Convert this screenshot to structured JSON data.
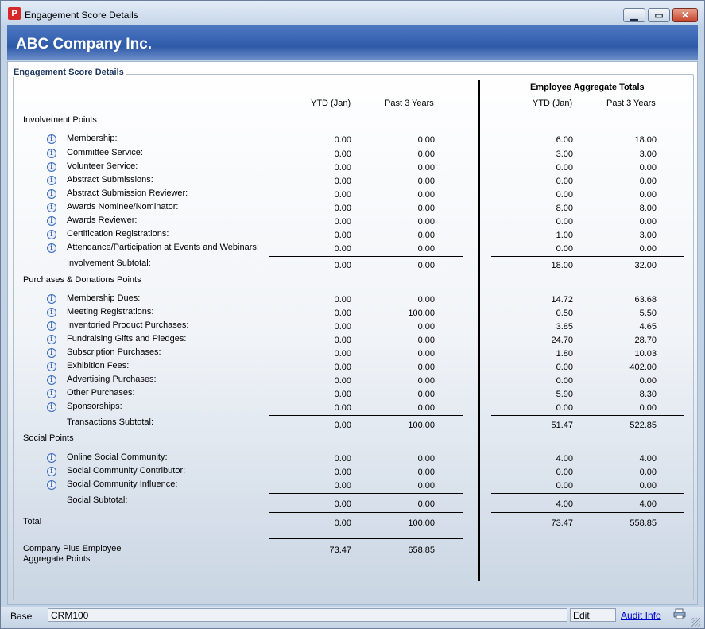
{
  "window": {
    "title": "Engagement Score Details",
    "app_icon": "P"
  },
  "banner": {
    "company": "ABC Company  Inc."
  },
  "section_title": "Engagement Score Details",
  "headers": {
    "ytd": "YTD (Jan)",
    "past3": "Past 3 Years",
    "employee_totals": "Employee Aggregate Totals",
    "emp_ytd": "YTD (Jan)",
    "emp_past3": "Past 3 Years"
  },
  "groups": [
    {
      "title": "Involvement Points",
      "rows": [
        {
          "label": "Membership:",
          "ytd": "0.00",
          "past3": "0.00",
          "emp_ytd": "6.00",
          "emp_past3": "18.00"
        },
        {
          "label": "Committee Service:",
          "ytd": "0.00",
          "past3": "0.00",
          "emp_ytd": "3.00",
          "emp_past3": "3.00"
        },
        {
          "label": "Volunteer Service:",
          "ytd": "0.00",
          "past3": "0.00",
          "emp_ytd": "0.00",
          "emp_past3": "0.00"
        },
        {
          "label": "Abstract Submissions:",
          "ytd": "0.00",
          "past3": "0.00",
          "emp_ytd": "0.00",
          "emp_past3": "0.00"
        },
        {
          "label": "Abstract Submission Reviewer:",
          "ytd": "0.00",
          "past3": "0.00",
          "emp_ytd": "0.00",
          "emp_past3": "0.00"
        },
        {
          "label": "Awards Nominee/Nominator:",
          "ytd": "0.00",
          "past3": "0.00",
          "emp_ytd": "8.00",
          "emp_past3": "8.00"
        },
        {
          "label": "Awards Reviewer:",
          "ytd": "0.00",
          "past3": "0.00",
          "emp_ytd": "0.00",
          "emp_past3": "0.00"
        },
        {
          "label": "Certification Registrations:",
          "ytd": "0.00",
          "past3": "0.00",
          "emp_ytd": "1.00",
          "emp_past3": "3.00"
        },
        {
          "label": "Attendance/Participation at Events and Webinars:",
          "ytd": "0.00",
          "past3": "0.00",
          "emp_ytd": "0.00",
          "emp_past3": "0.00"
        }
      ],
      "subtotal": {
        "label": "Involvement Subtotal:",
        "ytd": "0.00",
        "past3": "0.00",
        "emp_ytd": "18.00",
        "emp_past3": "32.00"
      }
    },
    {
      "title": "Purchases & Donations Points",
      "rows": [
        {
          "label": "Membership Dues:",
          "ytd": "0.00",
          "past3": "0.00",
          "emp_ytd": "14.72",
          "emp_past3": "63.68"
        },
        {
          "label": "Meeting Registrations:",
          "ytd": "0.00",
          "past3": "100.00",
          "emp_ytd": "0.50",
          "emp_past3": "5.50"
        },
        {
          "label": "Inventoried Product Purchases:",
          "ytd": "0.00",
          "past3": "0.00",
          "emp_ytd": "3.85",
          "emp_past3": "4.65"
        },
        {
          "label": "Fundraising Gifts and Pledges:",
          "ytd": "0.00",
          "past3": "0.00",
          "emp_ytd": "24.70",
          "emp_past3": "28.70"
        },
        {
          "label": "Subscription Purchases:",
          "ytd": "0.00",
          "past3": "0.00",
          "emp_ytd": "1.80",
          "emp_past3": "10.03"
        },
        {
          "label": "Exhibition Fees:",
          "ytd": "0.00",
          "past3": "0.00",
          "emp_ytd": "0.00",
          "emp_past3": "402.00"
        },
        {
          "label": "Advertising Purchases:",
          "ytd": "0.00",
          "past3": "0.00",
          "emp_ytd": "0.00",
          "emp_past3": "0.00"
        },
        {
          "label": "Other Purchases:",
          "ytd": "0.00",
          "past3": "0.00",
          "emp_ytd": "5.90",
          "emp_past3": "8.30"
        },
        {
          "label": "Sponsorships:",
          "ytd": "0.00",
          "past3": "0.00",
          "emp_ytd": "0.00",
          "emp_past3": "0.00"
        }
      ],
      "subtotal": {
        "label": "Transactions Subtotal:",
        "ytd": "0.00",
        "past3": "100.00",
        "emp_ytd": "51.47",
        "emp_past3": "522.85"
      }
    },
    {
      "title": "Social Points",
      "rows": [
        {
          "label": "Online Social Community:",
          "ytd": "0.00",
          "past3": "0.00",
          "emp_ytd": "4.00",
          "emp_past3": "4.00"
        },
        {
          "label": "Social Community Contributor:",
          "ytd": "0.00",
          "past3": "0.00",
          "emp_ytd": "0.00",
          "emp_past3": "0.00"
        },
        {
          "label": "Social Community Influence:",
          "ytd": "0.00",
          "past3": "0.00",
          "emp_ytd": "0.00",
          "emp_past3": "0.00"
        }
      ],
      "subtotal": {
        "label": "Social Subtotal:",
        "ytd": "0.00",
        "past3": "0.00",
        "emp_ytd": "4.00",
        "emp_past3": "4.00"
      }
    }
  ],
  "total": {
    "label": "Total",
    "ytd": "0.00",
    "past3": "100.00",
    "emp_ytd": "73.47",
    "emp_past3": "558.85"
  },
  "company_plus": {
    "label_line1": "Company Plus Employee",
    "label_line2": "Aggregate Points",
    "ytd": "73.47",
    "past3": "658.85"
  },
  "statusbar": {
    "base": "Base",
    "code": "CRM100",
    "mode": "Edit",
    "audit_link": "Audit Info"
  },
  "colors": {
    "banner": "#2e5aa8",
    "section_title": "#1d3660",
    "link": "#0000cc"
  }
}
